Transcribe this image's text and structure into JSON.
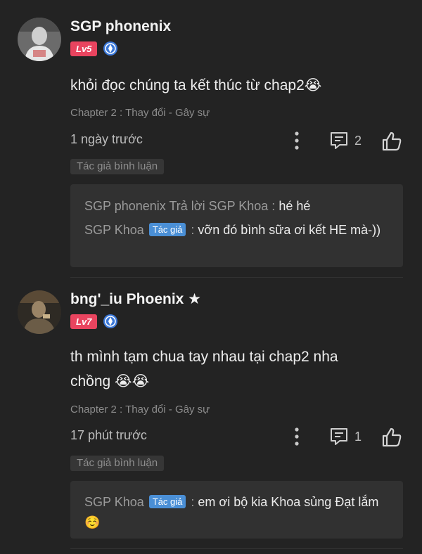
{
  "comments": [
    {
      "username": "SGP phonenix",
      "level": "Lv5",
      "content": "khỏi đọc chúng ta kết thúc từ chap2😭",
      "chapter": "Chapter 2 : Thay đổi - Gây sự",
      "time": "1 ngày trước",
      "reply_count": "2",
      "author_tag": "Tác giả bình luận",
      "replies": [
        {
          "name": "SGP phonenix",
          "connector": " Trả lời SGP Khoa : ",
          "badge": "",
          "text": "hé hé"
        },
        {
          "name": "SGP Khoa",
          "connector": "",
          "badge": "Tác giả",
          "sep": " : ",
          "text": "vỡn đó bình sữa ơi kết HE mà-))"
        }
      ]
    },
    {
      "username": "bng'_iu Phoenix ★",
      "level": "Lv7",
      "content": "th mình tạm chua tay nhau tại chap2 nha chồng 😭😭",
      "chapter": "Chapter 2 : Thay đổi - Gây sự",
      "time": "17 phút trước",
      "reply_count": "1",
      "author_tag": "Tác giả bình luận",
      "replies": [
        {
          "name": "SGP Khoa",
          "connector": "",
          "badge": "Tác giả",
          "sep": " : ",
          "text": "em ơi bộ kia Khoa sủng Đạt lắm☺️"
        }
      ]
    }
  ],
  "colors": {
    "background": "#232323",
    "level_badge": "#e9445f",
    "author_badge": "#4a8fd6",
    "reply_box": "#313131"
  },
  "icons": [
    "avatar",
    "shield-icon",
    "more-vertical-icon",
    "comment-icon",
    "thumbs-up-icon"
  ]
}
